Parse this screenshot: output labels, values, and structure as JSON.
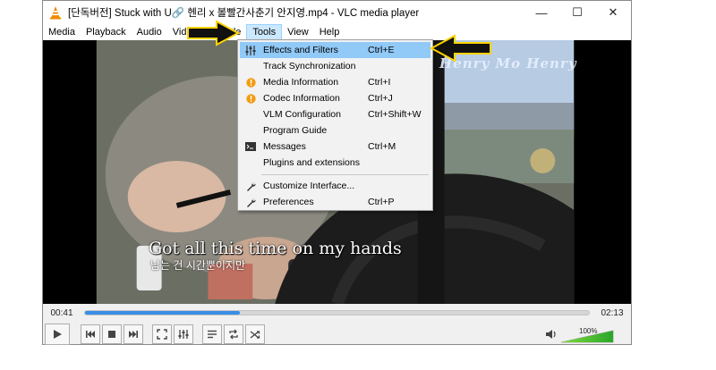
{
  "window": {
    "title": "[단독버전] Stuck with U🔗 헨리 x 볼빨간사춘기 안지영.mp4 - VLC media player",
    "controls": {
      "minimize": "—",
      "maximize": "☐",
      "close": "✕"
    }
  },
  "menubar": {
    "items": [
      {
        "label": "Media"
      },
      {
        "label": "Playback"
      },
      {
        "label": "Audio"
      },
      {
        "label": "Video"
      },
      {
        "label": "Subtitle"
      },
      {
        "label": "Tools"
      },
      {
        "label": "View"
      },
      {
        "label": "Help"
      }
    ],
    "active": "Tools"
  },
  "tools_menu": {
    "items": [
      {
        "label": "Effects and Filters",
        "shortcut": "Ctrl+E",
        "icon": "equalizer-icon",
        "highlighted": true
      },
      {
        "label": "Track Synchronization",
        "shortcut": "",
        "icon": ""
      },
      {
        "label": "Media Information",
        "shortcut": "Ctrl+I",
        "icon": "info-orange-icon"
      },
      {
        "label": "Codec Information",
        "shortcut": "Ctrl+J",
        "icon": "info-orange-icon"
      },
      {
        "label": "VLM Configuration",
        "shortcut": "Ctrl+Shift+W",
        "icon": ""
      },
      {
        "label": "Program Guide",
        "shortcut": "",
        "icon": ""
      },
      {
        "label": "Messages",
        "shortcut": "Ctrl+M",
        "icon": "terminal-icon"
      },
      {
        "label": "Plugins and extensions",
        "shortcut": "",
        "icon": ""
      },
      {
        "label": "Customize Interface...",
        "shortcut": "",
        "icon": "wrench-icon"
      },
      {
        "label": "Preferences",
        "shortcut": "Ctrl+P",
        "icon": "wrench-icon"
      }
    ]
  },
  "video": {
    "subtitle_en": "Got all this time on my hands",
    "subtitle_kr": "남는 건 시간뿐이지만",
    "watermark": "Henry Mo Henry"
  },
  "playback": {
    "elapsed": "00:41",
    "total": "02:13",
    "progress_fraction": 0.308,
    "volume_label": "100%",
    "volume_fraction": 1.0
  },
  "colors": {
    "accent": "#3a8ee6",
    "menu_highlight": "#91c9f7",
    "info_icon": "#f39c12",
    "annotation_arrow": "#ffd400"
  }
}
